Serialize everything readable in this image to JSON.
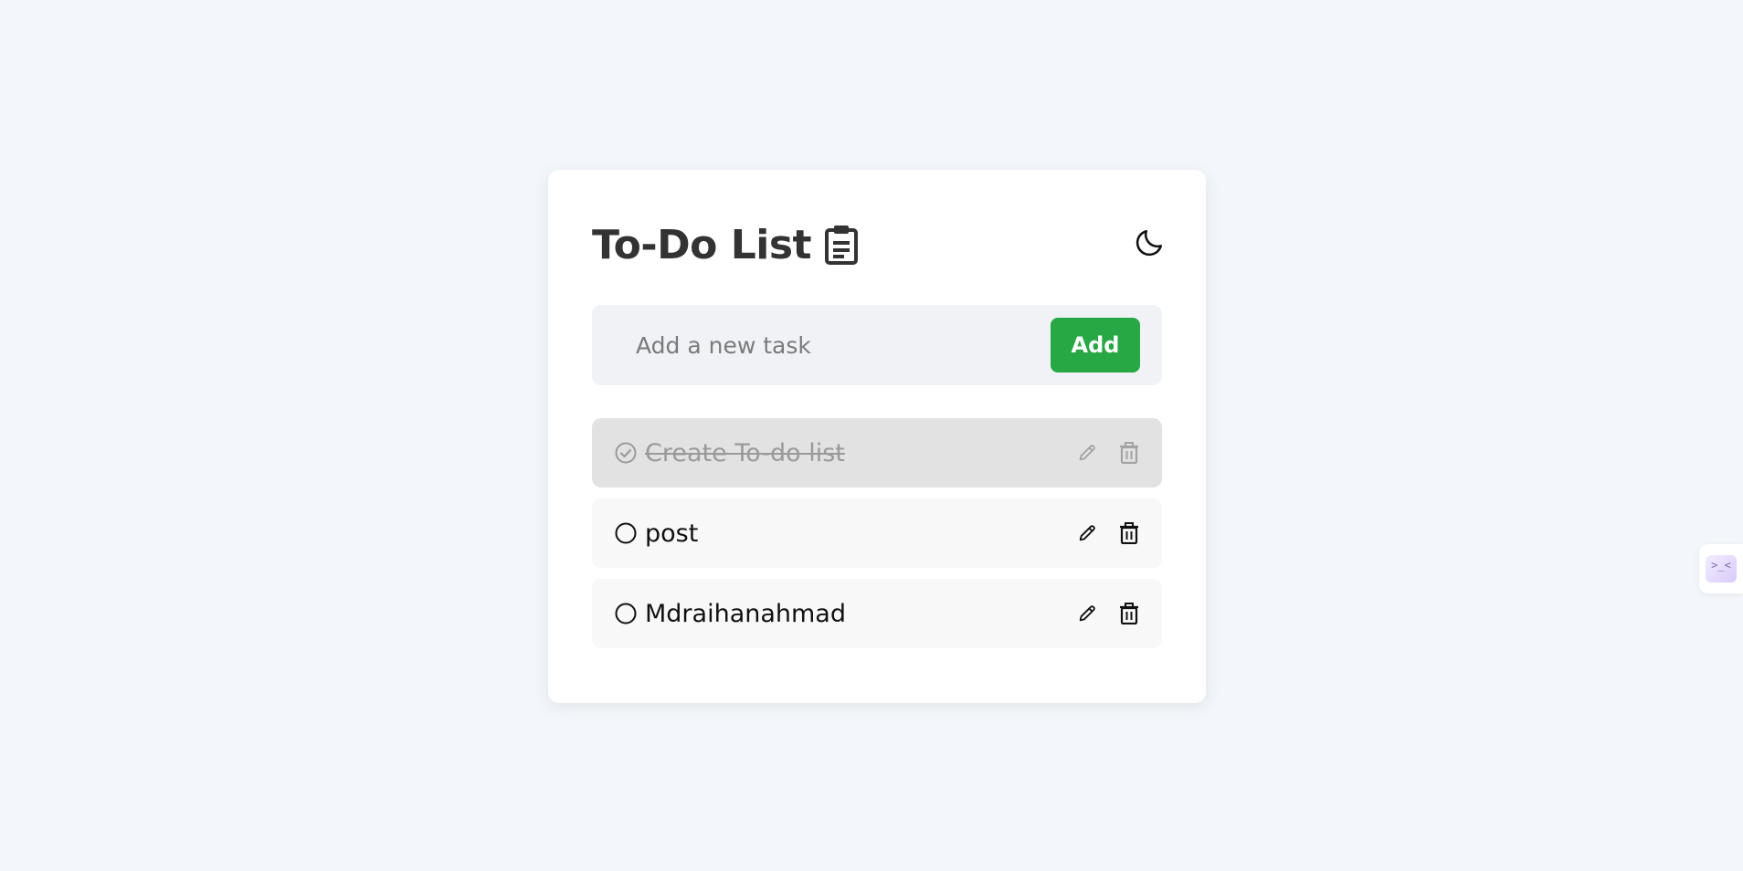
{
  "app": {
    "title": "To-Do List",
    "title_icon": "clipboard-icon",
    "theme_toggle_icon": "moon-icon"
  },
  "new_task": {
    "placeholder": "Add a new task",
    "value": "",
    "add_label": "Add"
  },
  "tasks": [
    {
      "text": "Create To-do list",
      "completed": true,
      "status_icon": "check-circle-icon"
    },
    {
      "text": "post",
      "completed": false,
      "status_icon": "circle-icon"
    },
    {
      "text": "Mdraihanahmad",
      "completed": false,
      "status_icon": "circle-icon"
    }
  ],
  "side_widget": {
    "icon": "face-icon",
    "text": ">_<"
  },
  "colors": {
    "background": "#f3f6fa",
    "card": "#ffffff",
    "accent": "#28a745",
    "completed_row": "#e2e2e2",
    "row": "#f8f8f8"
  }
}
